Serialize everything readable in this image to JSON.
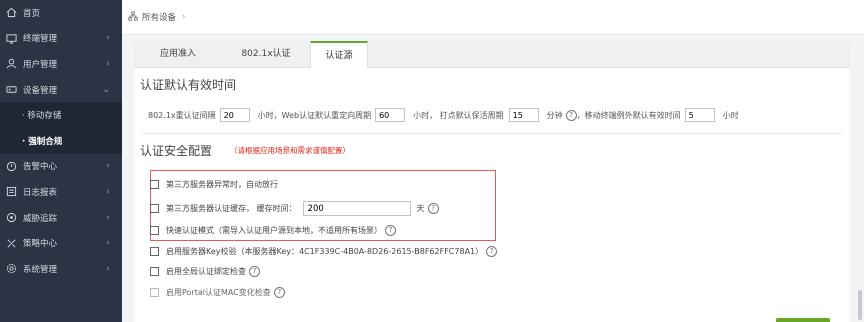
{
  "sidebar": {
    "items": [
      {
        "label": "首页",
        "icon": "home-icon",
        "arrow": ""
      },
      {
        "label": "终端管理",
        "icon": "monitor-icon",
        "arrow": "›"
      },
      {
        "label": "用户管理",
        "icon": "user-icon",
        "arrow": "›"
      },
      {
        "label": "设备管理",
        "icon": "device-icon",
        "arrow": "⌄"
      },
      {
        "label": "· 移动存储",
        "icon": "",
        "arrow": ""
      },
      {
        "label": "· 强制合规",
        "icon": "",
        "arrow": ""
      },
      {
        "label": "告警中心",
        "icon": "alarm-icon",
        "arrow": "›"
      },
      {
        "label": "日志报表",
        "icon": "log-icon",
        "arrow": "›"
      },
      {
        "label": "威胁追踪",
        "icon": "threat-icon",
        "arrow": "›"
      },
      {
        "label": "策略中心",
        "icon": "policy-icon",
        "arrow": "›"
      },
      {
        "label": "系统管理",
        "icon": "settings-icon",
        "arrow": "›"
      }
    ]
  },
  "breadcrumb": {
    "text": "所有设备",
    "chevron": "›"
  },
  "tabs": [
    {
      "label": "应用准入"
    },
    {
      "label": "802.1x认证"
    },
    {
      "label": "认证源"
    }
  ],
  "section1": {
    "title": "认证默认有效时间",
    "label_8021x": "802.1x重认证间隔",
    "val_8021x": "20",
    "label_web": "小时，Web认证默认重定向周期",
    "val_web": "60",
    "label_keepalive": "小时，  打点默认保活周期",
    "val_keepalive": "15",
    "label_min": "分钟",
    "label_mobile": "，移动终端例外默认有效时间",
    "val_mobile": "5",
    "label_hour": "小时"
  },
  "section2": {
    "title": "认证安全配置",
    "warning": "（请根据应用场景和需求谨慎配置）",
    "opt1": "第三方服务器异常时，自动放行",
    "opt2": "第三方服务器认证缓存，  缓存时间：",
    "opt2_value": "200",
    "opt2_unit": "天",
    "opt3": "快速认证模式（需导入认证用户源到本地，不适用所有场景）",
    "opt4": "启用服务器Key校验（本服务器Key：4C1F339C-4B0A-8D26-2615-B8F62FFC78A1）",
    "opt5": "启用全局认证绑定检查",
    "opt6": "启用Portal认证MAC变化检查"
  },
  "colors": {
    "accent": "#6aa62a",
    "sidebar": "#2b3445",
    "warning": "#e1251b"
  }
}
